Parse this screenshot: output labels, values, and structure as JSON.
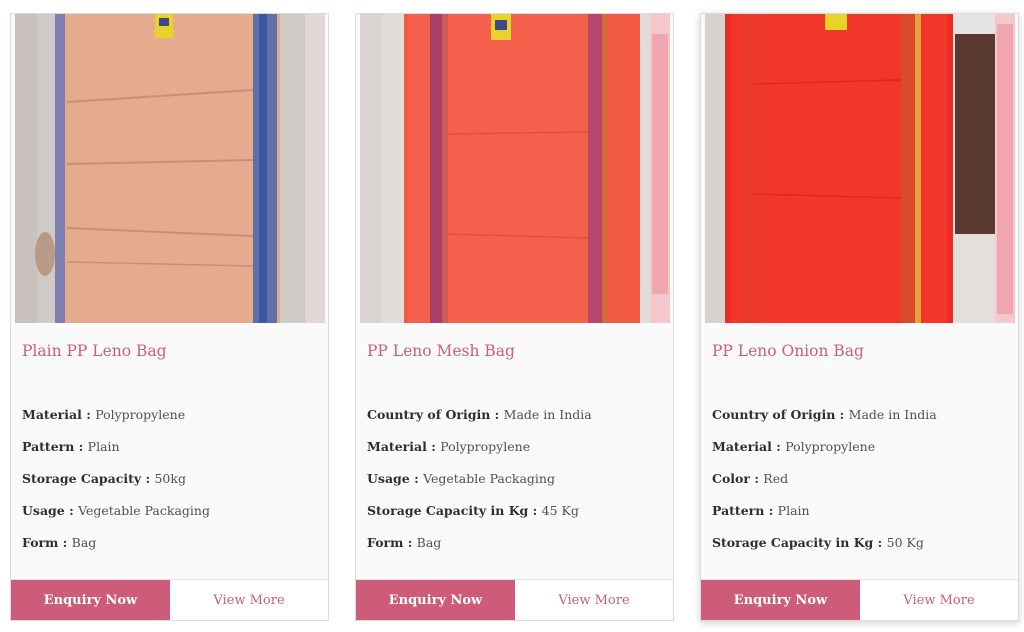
{
  "products": [
    {
      "name": "Plain PP Leno Bag",
      "image_icon": "orange-leno-bag-photo",
      "specs": [
        {
          "label": "Material",
          "value": "Polypropylene"
        },
        {
          "label": "Pattern",
          "value": "Plain"
        },
        {
          "label": "Storage Capacity",
          "value": "50kg"
        },
        {
          "label": "Usage",
          "value": "Vegetable Packaging"
        },
        {
          "label": "Form",
          "value": "Bag"
        }
      ],
      "enquiry_label": "Enquiry Now",
      "view_label": "View More"
    },
    {
      "name": "PP Leno Mesh Bag",
      "image_icon": "red-mesh-bag-photo",
      "specs": [
        {
          "label": "Country of Origin",
          "value": "Made in India"
        },
        {
          "label": "Material",
          "value": "Polypropylene"
        },
        {
          "label": "Usage",
          "value": "Vegetable Packaging"
        },
        {
          "label": "Storage Capacity in Kg",
          "value": "45 Kg"
        },
        {
          "label": "Form",
          "value": "Bag"
        }
      ],
      "enquiry_label": "Enquiry Now",
      "view_label": "View More"
    },
    {
      "name": "PP Leno Onion Bag",
      "image_icon": "red-onion-bag-photo",
      "specs": [
        {
          "label": "Country of Origin",
          "value": "Made in India"
        },
        {
          "label": "Material",
          "value": "Polypropylene"
        },
        {
          "label": "Color",
          "value": "Red"
        },
        {
          "label": "Pattern",
          "value": "Plain"
        },
        {
          "label": "Storage Capacity in Kg",
          "value": "50 Kg"
        }
      ],
      "enquiry_label": "Enquiry Now",
      "view_label": "View More"
    }
  ],
  "colors": {
    "accent": "#cd5c7a",
    "title": "#cc5f74",
    "card_border": "#dcdcdc"
  }
}
